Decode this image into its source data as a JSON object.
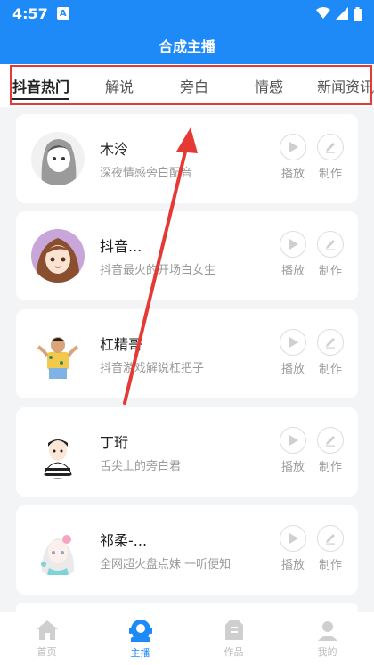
{
  "status": {
    "time": "4:57",
    "badge": "A"
  },
  "header": {
    "title": "合成主播"
  },
  "tabs": [
    {
      "label": "抖音热门",
      "active": true
    },
    {
      "label": "解说",
      "active": false
    },
    {
      "label": "旁白",
      "active": false
    },
    {
      "label": "情感",
      "active": false
    },
    {
      "label": "新闻资讯",
      "active": false
    }
  ],
  "items": [
    {
      "name": "木泠",
      "desc": "深夜情感旁白配音",
      "play": "播放",
      "make": "制作"
    },
    {
      "name": "抖音...",
      "desc": "抖音最火的开场白女生",
      "play": "播放",
      "make": "制作"
    },
    {
      "name": "杠精哥",
      "desc": "抖音游戏解说杠把子",
      "play": "播放",
      "make": "制作"
    },
    {
      "name": "丁珩",
      "desc": "舌尖上的旁白君",
      "play": "播放",
      "make": "制作"
    },
    {
      "name": "祁柔-...",
      "desc": "全网超火盘点妹 一听便知",
      "play": "播放",
      "make": "制作"
    }
  ],
  "nav": [
    {
      "label": "首页",
      "icon": "home-icon"
    },
    {
      "label": "主播",
      "icon": "headset-icon"
    },
    {
      "label": "作品",
      "icon": "works-icon"
    },
    {
      "label": "我的",
      "icon": "user-icon"
    }
  ],
  "colors": {
    "primary": "#1d8af7",
    "annotation": "#e53935"
  }
}
